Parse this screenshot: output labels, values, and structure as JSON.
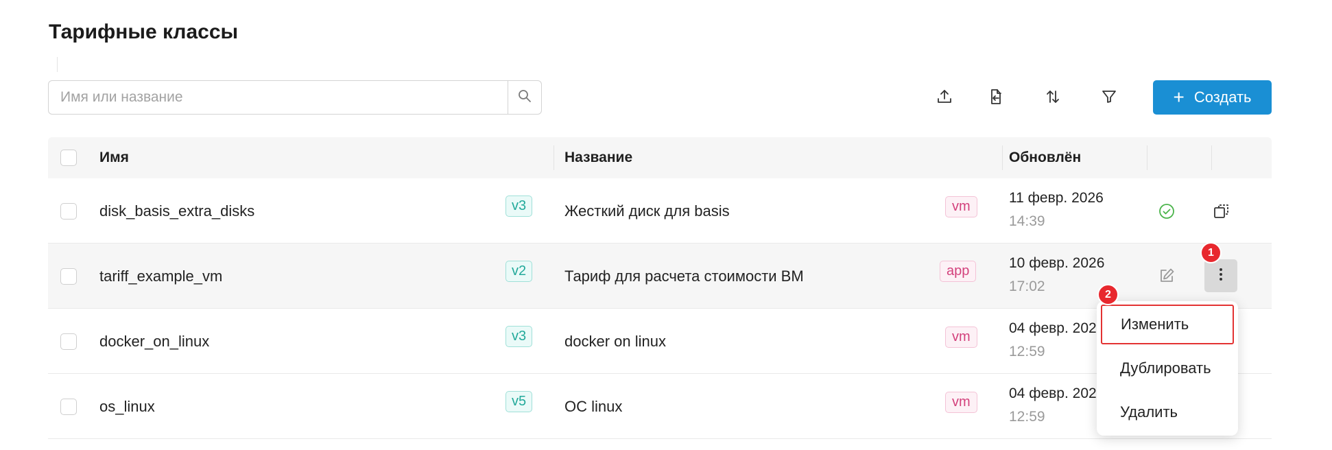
{
  "page": {
    "title": "Тарифные классы"
  },
  "search": {
    "placeholder": "Имя или название"
  },
  "toolbar": {
    "upload_icon": "upload-icon",
    "export_icon": "file-export-icon",
    "sort_icon": "sort-icon",
    "filter_icon": "filter-icon",
    "create_label": "Создать",
    "create_icon": "+"
  },
  "table": {
    "columns": {
      "name": "Имя",
      "title": "Название",
      "updated": "Обновлён"
    },
    "rows": [
      {
        "name": "disk_basis_extra_disks",
        "version": "v3",
        "title": "Жесткий диск для basis",
        "tag": "vm",
        "date": "11 февр. 2026",
        "time": "14:39",
        "status_icon": "check-circle-icon",
        "action_icon": "duplicate-icon"
      },
      {
        "name": "tariff_example_vm",
        "version": "v2",
        "title": "Тариф для расчета стоимости ВМ",
        "tag": "app",
        "date": "10 февр. 2026",
        "time": "17:02",
        "status_icon": "edit-icon",
        "action_icon": "more-vertical-icon"
      },
      {
        "name": "docker_on_linux",
        "version": "v3",
        "title": "docker on linux",
        "tag": "vm",
        "date": "04 февр. 202",
        "time": "12:59"
      },
      {
        "name": "os_linux",
        "version": "v5",
        "title": "ОС linux",
        "tag": "vm",
        "date": "04 февр. 202",
        "time": "12:59"
      }
    ]
  },
  "annotations": {
    "step1": "1",
    "step2": "2"
  },
  "context_menu": {
    "items": [
      "Изменить",
      "Дублировать",
      "Удалить"
    ]
  },
  "colors": {
    "primary": "#1a8fd4",
    "version_tag": "#21a99a",
    "type_tag": "#d3417c",
    "highlight": "#e33232"
  }
}
